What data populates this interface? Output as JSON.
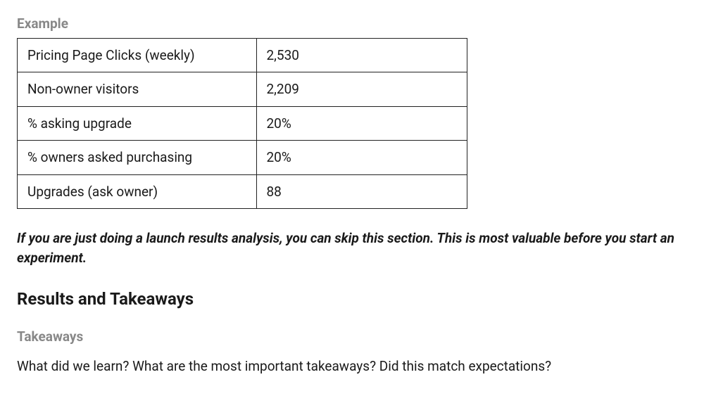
{
  "example": {
    "label": "Example",
    "rows": [
      {
        "metric": "Pricing Page Clicks (weekly)",
        "value": "2,530"
      },
      {
        "metric": "Non-owner visitors",
        "value": "2,209"
      },
      {
        "metric": "% asking upgrade",
        "value": "20%"
      },
      {
        "metric": "% owners asked purchasing",
        "value": "20%"
      },
      {
        "metric": "Upgrades (ask owner)",
        "value": "88"
      }
    ]
  },
  "note": "If you are just doing a launch results analysis, you can skip this section. This is most valuable before you start an experiment.",
  "results": {
    "heading": "Results and Takeaways",
    "takeaways_label": "Takeaways",
    "takeaways_body": "What did we learn? What are the most important takeaways? Did this match expectations?"
  }
}
